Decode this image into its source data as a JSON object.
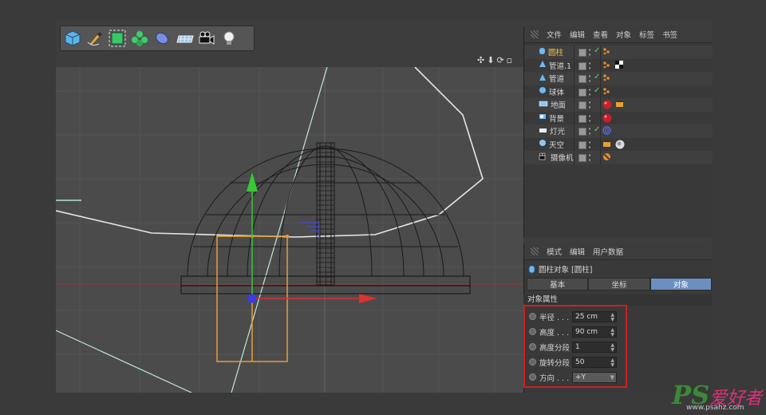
{
  "colors": {
    "accent": "#6b8fbf",
    "selected_text": "#f2c14e",
    "highlight_box": "#d01f1f",
    "axis_x": "#e03030",
    "axis_y": "#38c838",
    "axis_z": "#3a3af0",
    "selection_orange": "#e8a030"
  },
  "toolbar": {
    "tools": [
      "cube-icon",
      "pen-icon",
      "subdivide-icon",
      "cloner-icon",
      "deformer-icon",
      "floor-icon",
      "camera-icon",
      "light-icon"
    ]
  },
  "navicons": [
    "move-view-icon",
    "dolly-view-icon",
    "rotate-view-icon",
    "maximize-view-icon"
  ],
  "object_manager": {
    "menu": [
      "文件",
      "编辑",
      "查看",
      "对象",
      "标签",
      "书签"
    ],
    "objects": [
      {
        "name": "圆柱",
        "selected": true,
        "checked": true,
        "icon": "cylinder-icon",
        "tags": [
          "phong-tag-icon"
        ]
      },
      {
        "name": "管道.1",
        "selected": false,
        "checked": false,
        "icon": "tube-icon",
        "tags": [
          "phong-tag-icon",
          "checker-material-icon"
        ]
      },
      {
        "name": "管道",
        "selected": false,
        "checked": true,
        "icon": "tube-icon",
        "tags": [
          "phong-tag-icon"
        ]
      },
      {
        "name": "球体",
        "selected": false,
        "checked": true,
        "icon": "sphere-icon",
        "tags": [
          "phong-tag-icon"
        ]
      },
      {
        "name": "地面",
        "selected": false,
        "checked": false,
        "icon": "floor-icon",
        "tags": [
          "red-material-icon",
          "compositing-tag-icon"
        ]
      },
      {
        "name": "背景",
        "selected": false,
        "checked": false,
        "icon": "background-icon",
        "tags": [
          "red-material-icon"
        ]
      },
      {
        "name": "灯光",
        "selected": false,
        "checked": true,
        "icon": "light-icon",
        "tags": [
          "target-tag-icon"
        ]
      },
      {
        "name": "天空",
        "selected": false,
        "checked": false,
        "icon": "sky-icon",
        "tags": [
          "compositing-tag-icon",
          "hdr-material-icon"
        ]
      },
      {
        "name": "摄像机",
        "selected": false,
        "checked": false,
        "icon": "camera-icon",
        "tags": [
          "protection-tag-icon"
        ]
      }
    ]
  },
  "attributes": {
    "menu": [
      "模式",
      "编辑",
      "用户数据"
    ],
    "object_title": "圆柱对象 [圆柱]",
    "tabs": [
      {
        "label": "基本",
        "active": false
      },
      {
        "label": "坐标",
        "active": false
      },
      {
        "label": "对象",
        "active": true
      }
    ],
    "section": "对象属性",
    "fields": [
      {
        "label": "半径 . . .",
        "value": "25 cm",
        "type": "number"
      },
      {
        "label": "高度 . . .",
        "value": "90 cm",
        "type": "number"
      },
      {
        "label": "高度分段",
        "value": "1",
        "type": "number"
      },
      {
        "label": "旋转分段",
        "value": "50",
        "type": "number"
      },
      {
        "label": "方向 . . .",
        "value": "+Y",
        "type": "dropdown"
      }
    ]
  },
  "watermark": {
    "logo": "PS",
    "title": "爱好者",
    "url": "www.psahz.com"
  }
}
